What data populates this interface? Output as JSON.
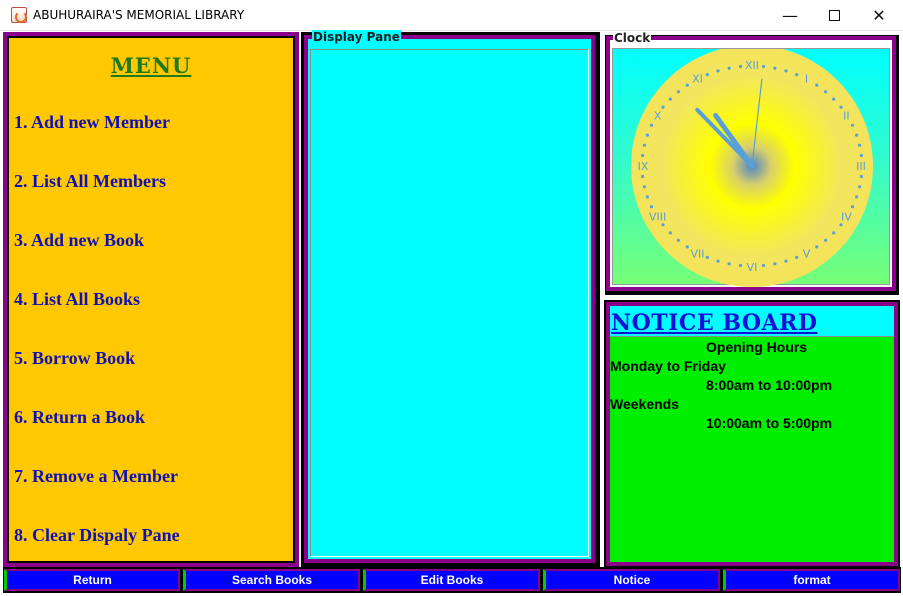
{
  "window": {
    "title": "ABUHURAIRA'S MEMORIAL LIBRARY",
    "minimize_glyph": "—",
    "close_glyph": "✕"
  },
  "menu": {
    "title": "MENU",
    "items": [
      "1. Add new Member",
      "2. List All Members",
      "3. Add new Book",
      "4. List All Books",
      "5. Borrow Book",
      "6. Return a Book",
      "7. Remove a Member",
      "8. Clear Dispaly Pane"
    ]
  },
  "display_pane": {
    "label": "Display Pane",
    "content": ""
  },
  "clock": {
    "label": "Clock",
    "numerals": [
      "XII",
      "I",
      "II",
      "III",
      "IV",
      "V",
      "VI",
      "VII",
      "VIII",
      "IX",
      "X",
      "XI"
    ],
    "time": {
      "hour": 10,
      "minute": 53,
      "second": 1
    },
    "colors": {
      "face_outer": "#f5e35a",
      "face_center": "#ffff00",
      "hands": "#5aa0d8",
      "numerals": "#5aa0d8"
    }
  },
  "notice_board": {
    "title": "NOTICE BOARD",
    "heading": "Opening Hours",
    "weekday_label": "Monday to Friday",
    "weekday_hours": "8:00am to 10:00pm",
    "weekend_label": "Weekends",
    "weekend_hours": "10:00am to 5:00pm"
  },
  "bottom_buttons": [
    "Return",
    "Search Books",
    "Edit Books",
    "Notice",
    "format"
  ],
  "colors": {
    "menu_bg": "#ffc800",
    "panel_border": "#8b008b",
    "display_bg": "#00ffff",
    "notice_bg": "#00ee00",
    "menu_text": "#1010b4",
    "menu_title": "#1f7a1f",
    "button_bg": "#0000ff"
  }
}
